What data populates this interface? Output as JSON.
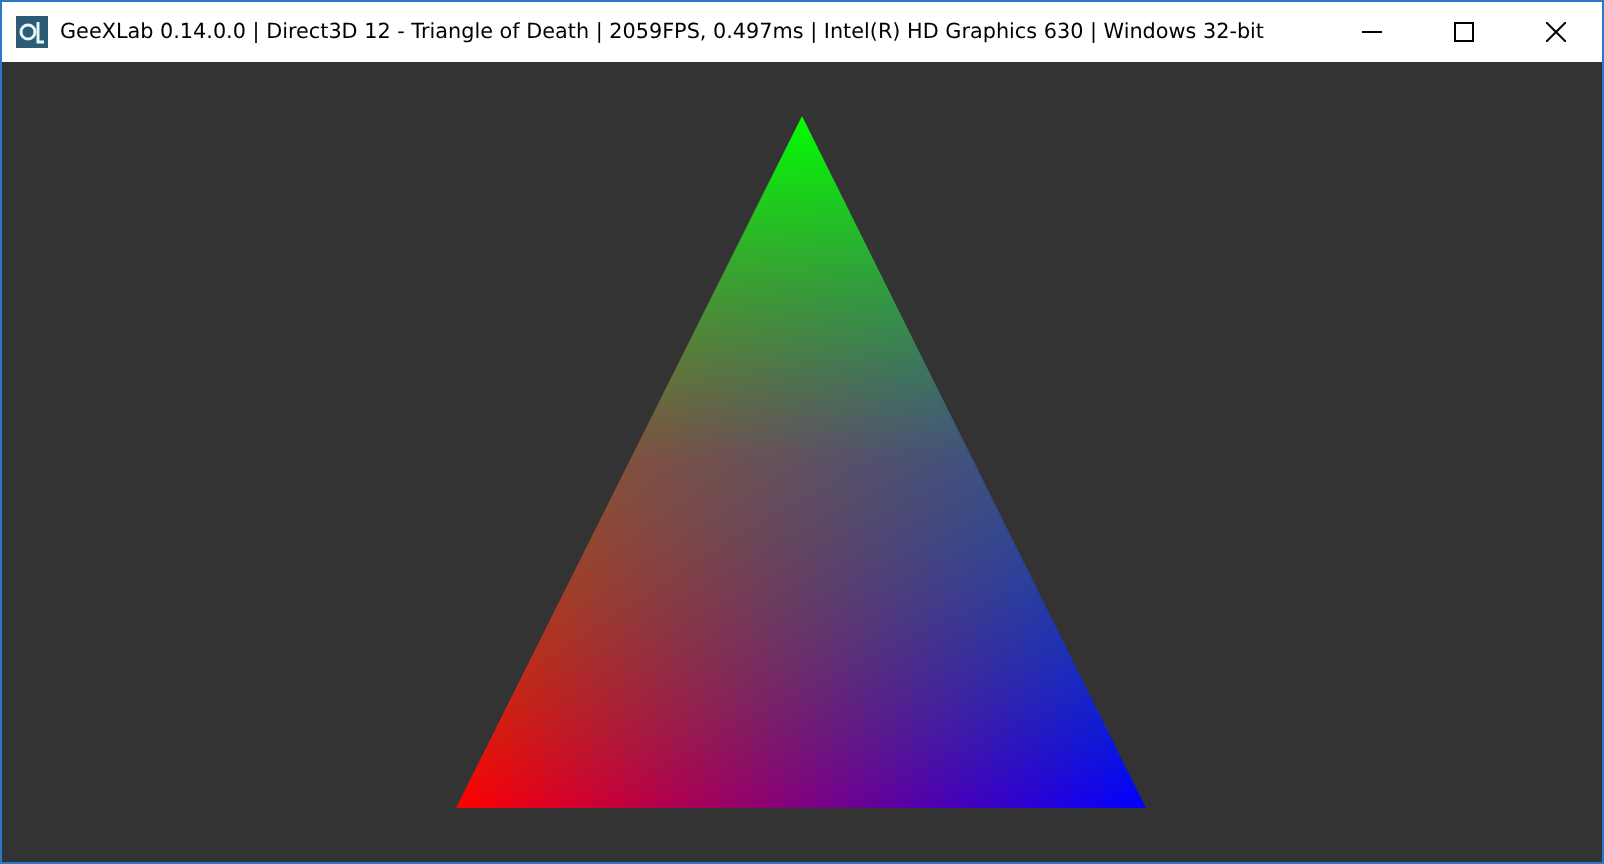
{
  "window": {
    "title": "GeeXLab 0.14.0.0 | Direct3D 12 - Triangle of Death | 2059FPS, 0.497ms | Intel(R) HD Graphics 630 | Windows 32-bit"
  }
}
